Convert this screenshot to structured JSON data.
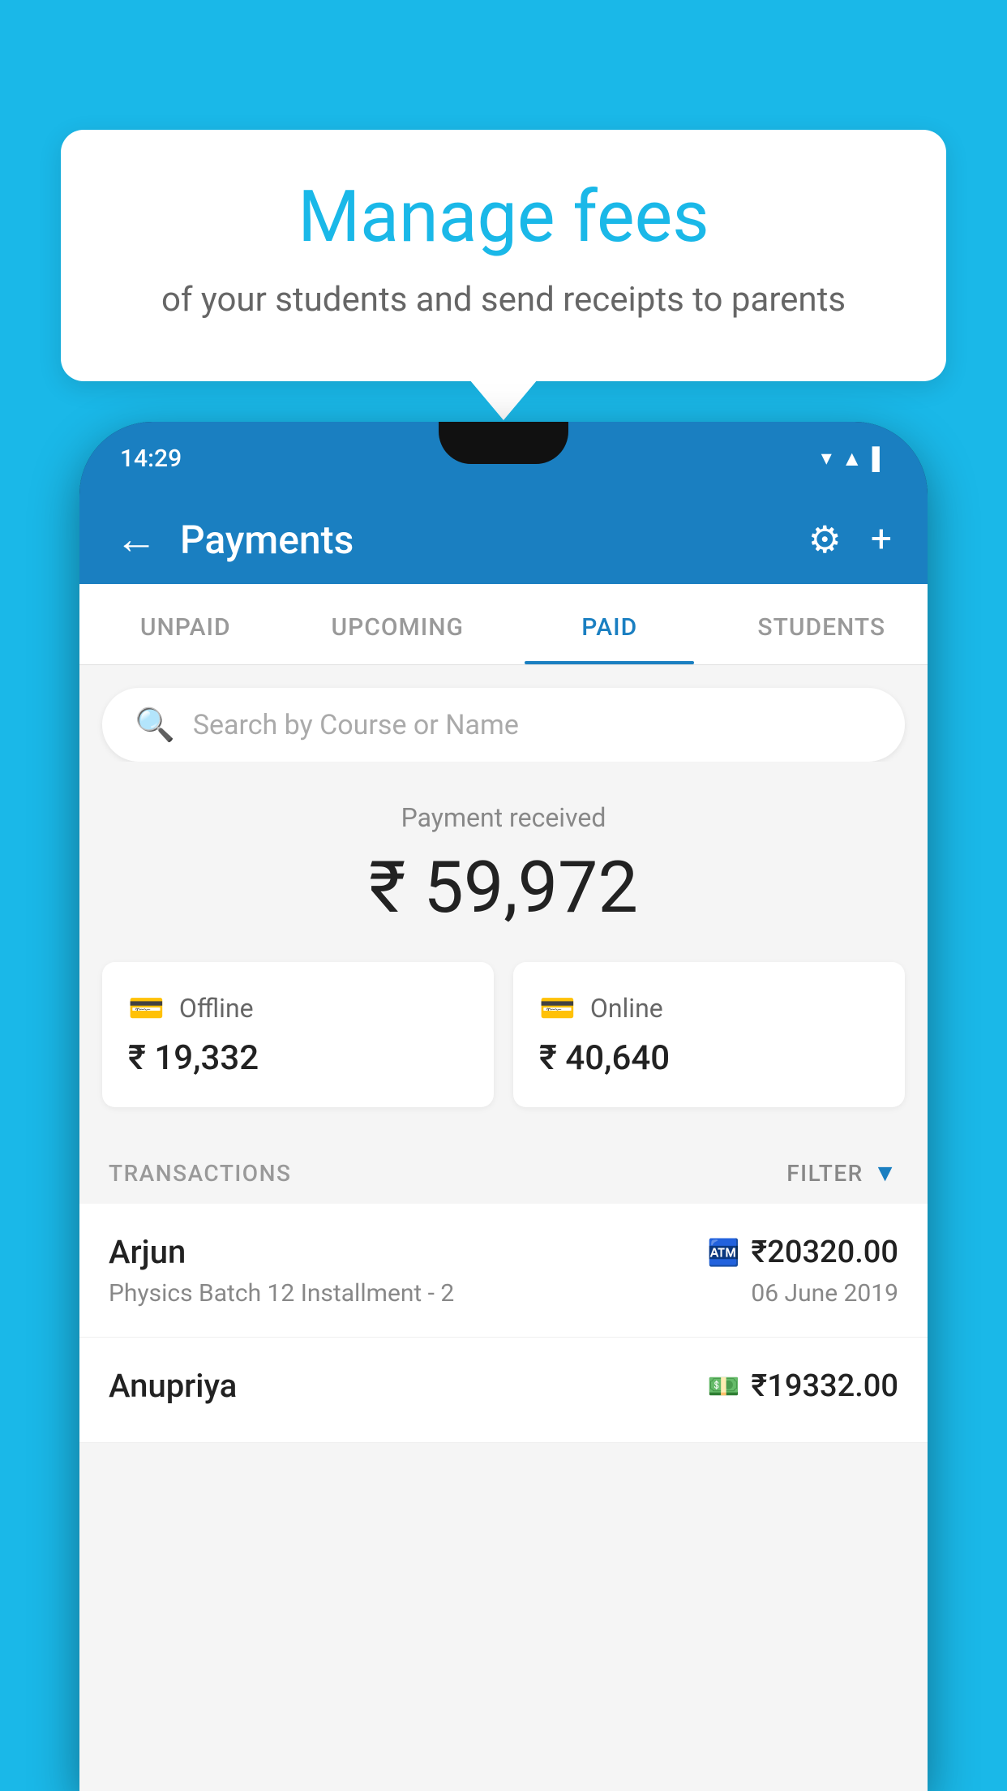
{
  "background_color": "#1ab8e8",
  "bubble": {
    "title": "Manage fees",
    "subtitle": "of your students and send receipts to parents"
  },
  "status_bar": {
    "time": "14:29",
    "icons": [
      "▼",
      "▲",
      "▌"
    ]
  },
  "header": {
    "title": "Payments",
    "back_label": "←",
    "settings_icon": "⚙",
    "add_icon": "+"
  },
  "tabs": [
    {
      "label": "UNPAID",
      "active": false
    },
    {
      "label": "UPCOMING",
      "active": false
    },
    {
      "label": "PAID",
      "active": true
    },
    {
      "label": "STUDENTS",
      "active": false
    }
  ],
  "search": {
    "placeholder": "Search by Course or Name"
  },
  "payment_received": {
    "label": "Payment received",
    "amount": "₹ 59,972"
  },
  "payment_cards": [
    {
      "icon": "offline",
      "label": "Offline",
      "amount": "₹ 19,332"
    },
    {
      "icon": "online",
      "label": "Online",
      "amount": "₹ 40,640"
    }
  ],
  "transactions_label": "TRANSACTIONS",
  "filter_label": "FILTER",
  "transactions": [
    {
      "name": "Arjun",
      "type_icon": "card",
      "amount": "₹20320.00",
      "description": "Physics Batch 12 Installment - 2",
      "date": "06 June 2019"
    },
    {
      "name": "Anupriya",
      "type_icon": "cash",
      "amount": "₹19332.00",
      "description": "",
      "date": ""
    }
  ]
}
